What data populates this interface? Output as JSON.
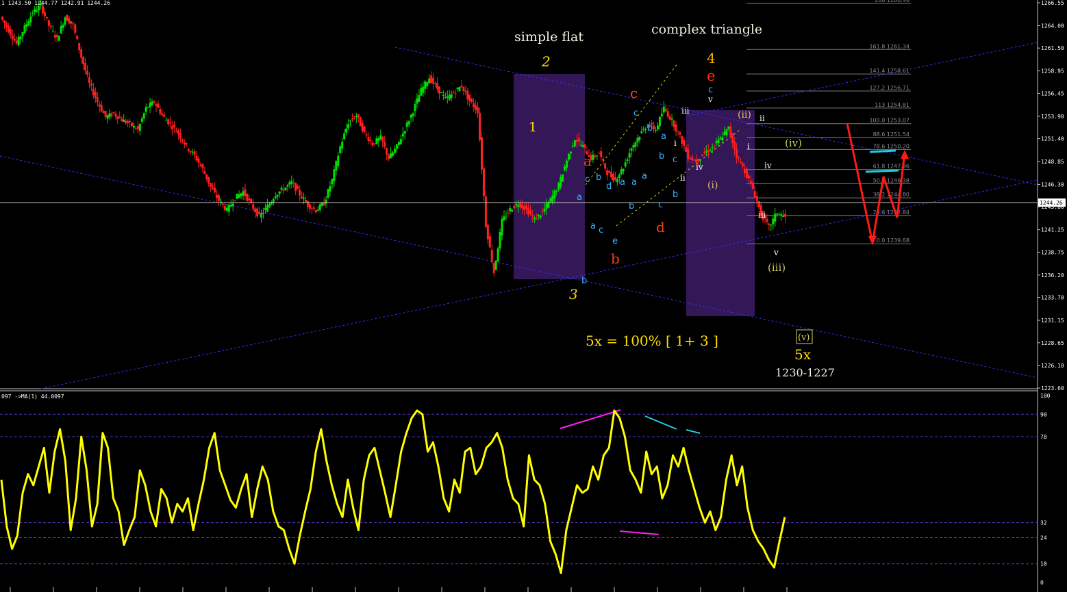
{
  "header": {
    "ohlc_text": "1  1243.50 1244.77 1242.91 1244.26",
    "indicator_text": "097  ->MA(1) 44.0097"
  },
  "price_label": "1244.26",
  "colors": {
    "background": "#000000",
    "bull_candle": "#00e000",
    "bear_candle": "#ff2020",
    "wave_box": "#3a1a60",
    "channel": "#3030ff",
    "oscillator": "#ffff00",
    "fib_line": "#7a7a7a",
    "yellow_label": "#ffe000",
    "red_label": "#ff3010",
    "blue_label": "#3ab0ff",
    "cyan_mark": "#20d0e0",
    "magenta_mark": "#ff20ff"
  },
  "annotations": {
    "simple_flat": "simple flat",
    "complex_triangle": "complex triangle",
    "wave1": "1",
    "wave2": "2",
    "wave3": "3",
    "wave4": "4",
    "wave4_e": "e",
    "wave4_c_v": "c",
    "wave4_v": "v",
    "red_a": "a",
    "red_b": "b",
    "red_c": "c",
    "red_d": "d",
    "target_formula": "5x = 100% [ 1+ 3 ]",
    "target_label": "5x",
    "target_range": "1230-1227",
    "box_v": "(v)",
    "sub_i": "(i)",
    "sub_ii": "(ii)",
    "sub_iii": "(iii)",
    "sub_iv": "(iv)",
    "roman_ii": "ii",
    "roman_iii": "iii",
    "roman_iv": "iv",
    "roman_v": "v",
    "roman_i": "i",
    "small_iii": "iii",
    "small_iv": "iv",
    "small_ii": "ii",
    "small_i": "i",
    "blue_b": "b",
    "blue_a1": "a",
    "blue_b1": "b",
    "blue_c1": "c",
    "blue_a2": "a",
    "blue_c2": "c",
    "blue_d1": "d",
    "blue_e1": "e",
    "blue_a3": "a",
    "blue_b2": "b",
    "blue_c3": "c",
    "blue_a4": "a",
    "blue_c4": "c",
    "blue_b3": "b",
    "blue_a5": "a",
    "blue_b4": "b",
    "blue_a6": "a",
    "blue_c5": "c",
    "blue_b5": "b"
  },
  "chart_data": [
    {
      "type": "line",
      "title": "",
      "price_axis": {
        "min": 1223.6,
        "max": 1266.55,
        "ticks": [
          "1266.55",
          "1264.00",
          "1261.50",
          "1258.95",
          "1256.45",
          "1253.90",
          "1251.40",
          "1248.85",
          "1246.30",
          "1243.80",
          "1241.25",
          "1238.75",
          "1236.20",
          "1233.70",
          "1231.15",
          "1228.65",
          "1226.10",
          "1223.60"
        ]
      },
      "fibonacci_levels": [
        {
          "label": "200 1266.46",
          "value": 1266.46
        },
        {
          "label": "161.8 1261.34",
          "value": 1261.34
        },
        {
          "label": "141.4 1258.61",
          "value": 1258.61
        },
        {
          "label": "127.2 1256.71",
          "value": 1256.71
        },
        {
          "label": "113 1254.81",
          "value": 1254.81
        },
        {
          "label": "100.0 1253.07",
          "value": 1253.07
        },
        {
          "label": "88.6 1251.54",
          "value": 1251.54
        },
        {
          "label": "78.6 1250.20",
          "value": 1250.2
        },
        {
          "label": "61.8 1247.96",
          "value": 1247.96
        },
        {
          "label": "50.0 1246.38",
          "value": 1246.38
        },
        {
          "label": "38.2 1244.80",
          "value": 1244.8
        },
        {
          "label": "23.6 1242.84",
          "value": 1242.84
        },
        {
          "label": "0.0 1239.68",
          "value": 1239.68
        }
      ],
      "close_path": [
        1265.0,
        1263.5,
        1262.0,
        1263.8,
        1265.5,
        1266.2,
        1264.0,
        1262.5,
        1265.0,
        1264.0,
        1260.5,
        1257.5,
        1255.5,
        1253.8,
        1254.2,
        1253.5,
        1253.0,
        1252.4,
        1254.8,
        1255.5,
        1254.0,
        1253.0,
        1252.0,
        1250.5,
        1249.5,
        1248.0,
        1246.0,
        1244.5,
        1243.4,
        1244.8,
        1245.5,
        1244.0,
        1242.7,
        1243.8,
        1245.2,
        1245.8,
        1246.5,
        1245.2,
        1244.0,
        1243.4,
        1244.2,
        1246.8,
        1250.5,
        1253.2,
        1254.0,
        1252.0,
        1250.8,
        1251.5,
        1249.2,
        1250.5,
        1252.5,
        1254.5,
        1256.8,
        1258.2,
        1257.0,
        1255.8,
        1256.5,
        1257.3,
        1255.6,
        1254.5,
        1241.8,
        1236.5,
        1242.2,
        1243.5,
        1244.2,
        1243.5,
        1242.4,
        1243.2,
        1244.6,
        1246.2,
        1249.0,
        1251.4,
        1250.5,
        1249.2,
        1249.8,
        1247.6,
        1246.8,
        1248.2,
        1250.4,
        1251.8,
        1253.0,
        1252.4,
        1254.8,
        1253.4,
        1251.6,
        1249.4,
        1248.9,
        1249.8,
        1250.4,
        1251.4,
        1252.6,
        1249.5,
        1247.8,
        1245.8,
        1243.0,
        1241.5,
        1243.2,
        1242.6
      ]
    },
    {
      "type": "line",
      "title": "",
      "ylim": [
        0,
        100
      ],
      "levels": [
        90,
        78,
        32,
        24,
        10
      ],
      "ticks": [
        "100",
        "90",
        "78",
        "32",
        "24",
        "10",
        "0"
      ],
      "series": [
        {
          "values": [
            55,
            30,
            18,
            25,
            48,
            58,
            52,
            62,
            72,
            48,
            70,
            82,
            65,
            28,
            45,
            78,
            60,
            30,
            42,
            80,
            72,
            45,
            38,
            20,
            28,
            35,
            60,
            52,
            38,
            30,
            50,
            45,
            32,
            42,
            38,
            45,
            28,
            42,
            55,
            72,
            80,
            60,
            52,
            44,
            40,
            50,
            58,
            35,
            50,
            62,
            55,
            38,
            30,
            28,
            18,
            10,
            25,
            38,
            50,
            70,
            82,
            65,
            52,
            42,
            35,
            55,
            40,
            28,
            55,
            68,
            72,
            60,
            48,
            35,
            52,
            70,
            80,
            88,
            92,
            90,
            70,
            75,
            62,
            45,
            38,
            55,
            48,
            70,
            72,
            58,
            62,
            72,
            75,
            80,
            72,
            55,
            45,
            42,
            30,
            68,
            55,
            52,
            42,
            22,
            15,
            5,
            28,
            40,
            52,
            48,
            50,
            62,
            55,
            68,
            72,
            92,
            88,
            78,
            60,
            55,
            48,
            70,
            58,
            62,
            45,
            52,
            68,
            62,
            72,
            60,
            50,
            40,
            32,
            38,
            28,
            35,
            55,
            68,
            52,
            62,
            40,
            28,
            22,
            18,
            12,
            8,
            22,
            35
          ]
        }
      ]
    }
  ]
}
